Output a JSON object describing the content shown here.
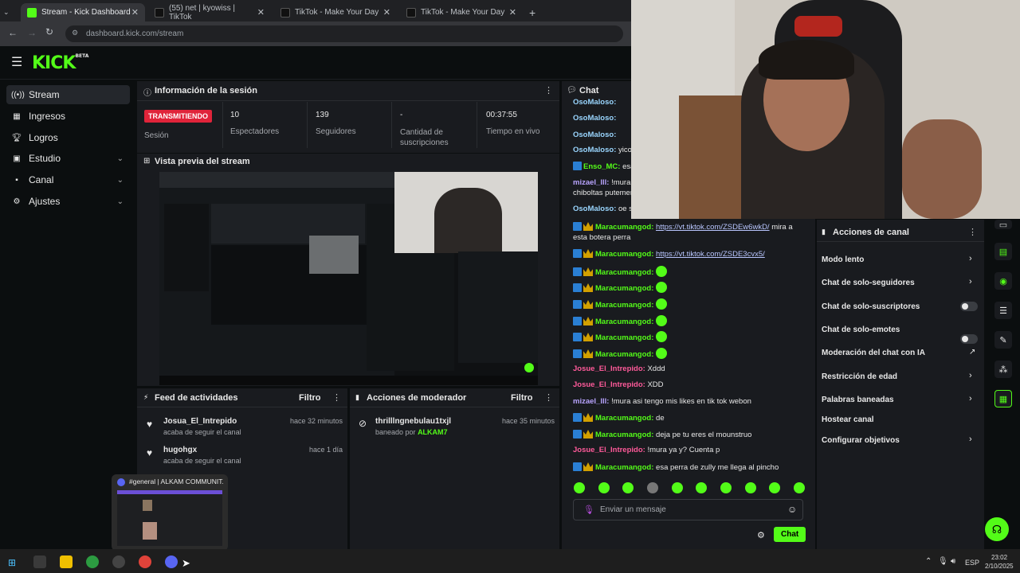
{
  "browser": {
    "tabs": [
      {
        "label": "Stream - Kick Dashboard",
        "active": true
      },
      {
        "label": "(55) net | kyowiss | TikTok",
        "active": false
      },
      {
        "label": "TikTok - Make Your Day",
        "active": false
      },
      {
        "label": "TikTok - Make Your Day",
        "active": false
      }
    ],
    "url": "dashboard.kick.com/stream"
  },
  "logo": {
    "text": "KICK",
    "tag": "BETA"
  },
  "sidebar": {
    "items": [
      {
        "label": "Stream",
        "icon": "broadcast-icon"
      },
      {
        "label": "Ingresos",
        "icon": "cash-icon"
      },
      {
        "label": "Logros",
        "icon": "trophy-icon"
      },
      {
        "label": "Estudio",
        "icon": "layout-icon"
      },
      {
        "label": "Canal",
        "icon": "channel-icon"
      },
      {
        "label": "Ajustes",
        "icon": "gear-icon"
      }
    ]
  },
  "session": {
    "title": "Información de la sesión",
    "status_badge": "TRANSMITIENDO",
    "status_label": "Sesión",
    "stats": [
      {
        "value": "10",
        "label": "Espectadores"
      },
      {
        "value": "139",
        "label": "Seguidores"
      },
      {
        "value": "-",
        "label": "Cantidad de suscripciones"
      },
      {
        "value": "00:37:55",
        "label": "Tiempo en vivo"
      }
    ]
  },
  "preview": {
    "title": "Vista previa del stream"
  },
  "activity": {
    "title": "Feed de actividades",
    "filter": "Filtro",
    "items": [
      {
        "user": "Josua_El_Intrepido",
        "time": "hace 32 minutos",
        "action": "acaba de seguir el canal"
      },
      {
        "user": "hugohgx",
        "time": "hace 1 día",
        "action": "acaba de seguir el canal"
      }
    ]
  },
  "modactions": {
    "title": "Acciones de moderador",
    "filter": "Filtro",
    "items": [
      {
        "user": "thrilllngnebulau1txjl",
        "time": "hace 35 minutos",
        "action_prefix": "baneado por",
        "by": "ALKAM7"
      }
    ]
  },
  "chat": {
    "title": "Chat",
    "messages": [
      {
        "user": "OsoMaloso",
        "text": "",
        "style": "c"
      },
      {
        "user": "OsoMaloso",
        "text": "",
        "style": "c"
      },
      {
        "user": "OsoMaloso",
        "text": "yico",
        "style": "c"
      },
      {
        "user": "Enso_MC",
        "text": "esa",
        "style": "g"
      },
      {
        "user": "mizael_lll",
        "text": "!mura",
        "style": "l"
      },
      {
        "user": "",
        "text": "chiboltas putemer",
        "style": "l"
      },
      {
        "user": "OsoMaloso",
        "text": "oe sa",
        "style": "c"
      }
    ],
    "messages_lower": [
      {
        "user": "Maracumangod",
        "text": "https://vt.tiktok.com/ZSDEw6wkD/",
        "suffix": " mira a",
        "link": true,
        "style": "g"
      },
      {
        "user": "",
        "text": "esta botera perra",
        "style": "plain"
      },
      {
        "user": "Maracumangod",
        "text": "https://vt.tiktok.com/ZSDE3cvx5/",
        "suffix": "",
        "link": true,
        "style": "g"
      },
      {
        "user": "Maracumangod",
        "text": "",
        "emote": true,
        "style": "g"
      },
      {
        "user": "Maracumangod",
        "text": "",
        "emote": true,
        "style": "g"
      },
      {
        "user": "Maracumangod",
        "text": "",
        "emote": true,
        "style": "g"
      },
      {
        "user": "Maracumangod",
        "text": "",
        "emote": true,
        "style": "g"
      },
      {
        "user": "Maracumangod",
        "text": "",
        "emote": true,
        "style": "g"
      },
      {
        "user": "Maracumangod",
        "text": "",
        "emote": true,
        "style": "g"
      },
      {
        "user": "Josue_El_Intrepido",
        "text": "Xddd",
        "style": "p"
      },
      {
        "user": "Josue_El_Intrepido",
        "text": "XDD",
        "style": "p"
      },
      {
        "user": "mizael_lll",
        "text": "!mura asi tengo mis likes en tik tok webon",
        "style": "l"
      },
      {
        "user": "Maracumangod",
        "text": "de",
        "style": "g"
      },
      {
        "user": "Maracumangod",
        "text": "deja pe tu eres el mounstruo",
        "style": "g"
      },
      {
        "user": "Josue_El_Intrepido",
        "text": "!mura ya y? Cuenta p",
        "style": "p"
      },
      {
        "user": "Maracumangod",
        "text": "esa perra de zully me llega al pincho",
        "style": "g"
      }
    ],
    "input_placeholder": "Enviar un mensaje",
    "send_label": "Chat"
  },
  "channel_actions": {
    "title": "Acciones de canal",
    "items": [
      {
        "label": "Modo lento",
        "control": "arrow"
      },
      {
        "label": "Chat de solo-seguidores",
        "control": "arrow"
      },
      {
        "label": "Chat de solo-suscriptores",
        "control": "toggle"
      },
      {
        "label": "Chat de solo-emotes",
        "control": "toggle"
      },
      {
        "label": "Moderación del chat con IA",
        "control": "external"
      },
      {
        "label": "Restricción de edad",
        "control": "arrow"
      },
      {
        "label": "Palabras baneadas",
        "control": "arrow"
      },
      {
        "label": "Hostear canal",
        "control": "none"
      },
      {
        "label": "Configurar objetivos",
        "control": "arrow"
      }
    ]
  },
  "discord_preview": {
    "title": "#general | ALKAM COMMUNIT..."
  },
  "taskbar": {
    "language": "ESP",
    "time": "23:02",
    "date": "2/10/2025"
  },
  "colors": {
    "accent": "#53fc18",
    "live": "#e0243a",
    "panel": "#191b1f"
  }
}
